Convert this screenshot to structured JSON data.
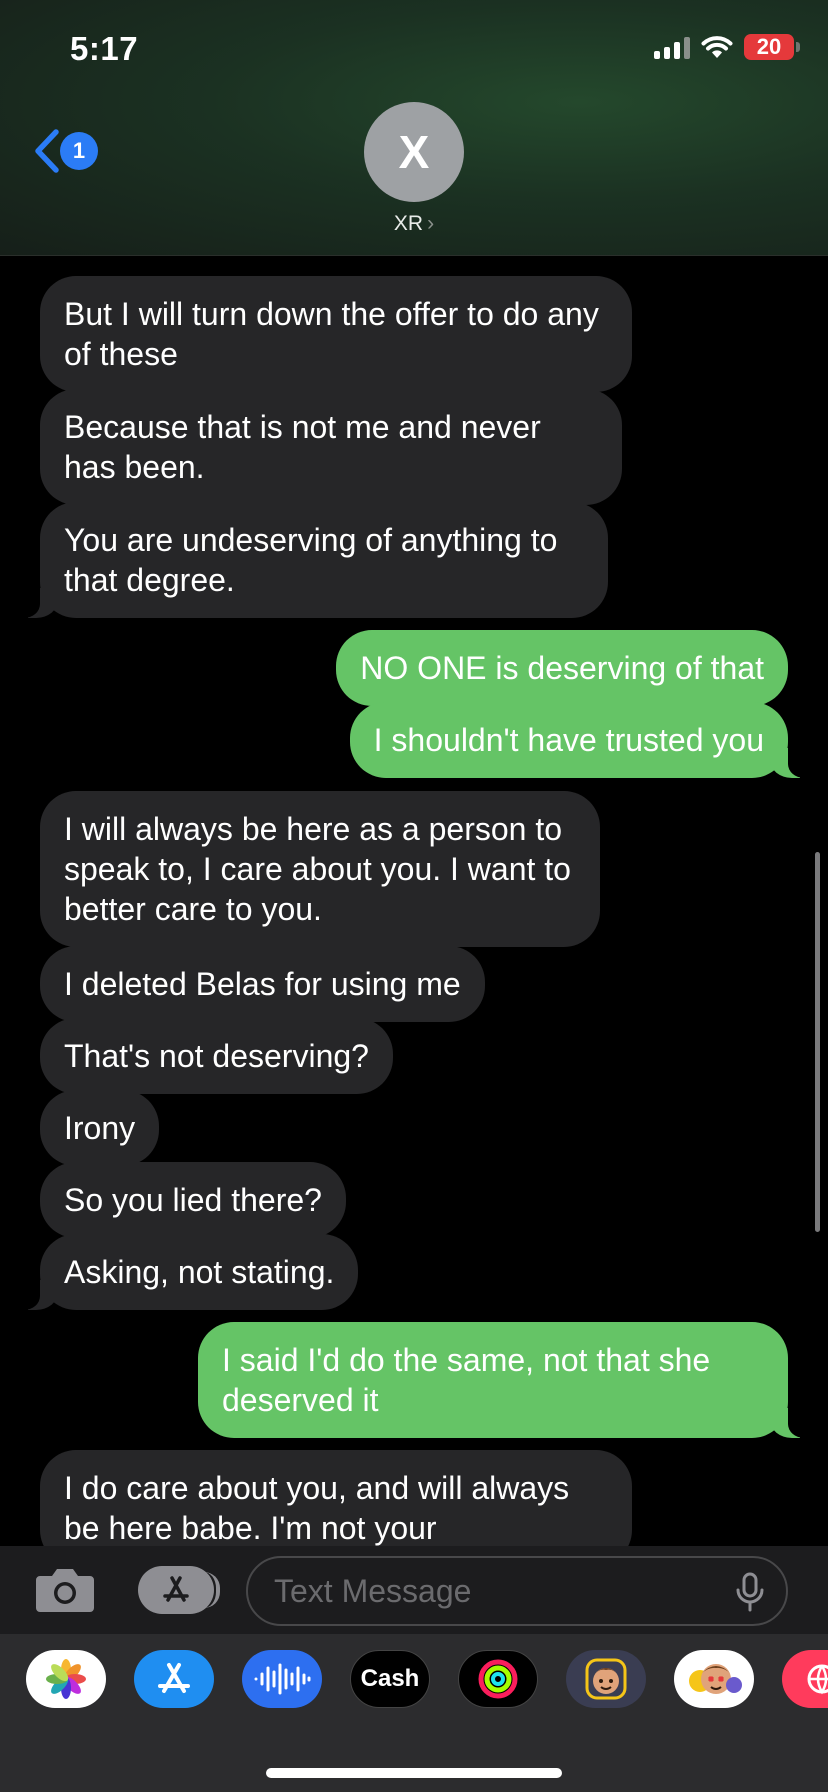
{
  "status": {
    "time": "5:17",
    "battery": "20"
  },
  "header": {
    "back_badge": "1",
    "avatar_initial": "X",
    "contact_name": "XR",
    "chevron": "›"
  },
  "messages": [
    {
      "from": "them",
      "text": "But I will turn down the offer to do any of these"
    },
    {
      "from": "them",
      "text": "Because that is not me and never has been."
    },
    {
      "from": "them",
      "text": "You are undeserving of anything to that degree."
    },
    {
      "from": "me",
      "text": "NO ONE is deserving of that"
    },
    {
      "from": "me",
      "text": "I shouldn't have trusted you"
    },
    {
      "from": "them",
      "text": "I will always be here as a person to speak to, I care about you. I want to better care to you."
    },
    {
      "from": "them",
      "text": "I deleted Belas for using me"
    },
    {
      "from": "them",
      "text": "That's not deserving?"
    },
    {
      "from": "them",
      "text": "Irony"
    },
    {
      "from": "them",
      "text": "So you lied there?"
    },
    {
      "from": "them",
      "text": "Asking, not stating."
    },
    {
      "from": "me",
      "text": "I said I'd do the same, not that she deserved it"
    },
    {
      "from": "them",
      "text": "I do care about you, and will always be here babe. I'm not your"
    }
  ],
  "input": {
    "placeholder": "Text Message"
  },
  "apps": [
    {
      "name": "photos-app"
    },
    {
      "name": "app-store-app"
    },
    {
      "name": "audio-message-app"
    },
    {
      "name": "apple-cash-app",
      "label": "Cash"
    },
    {
      "name": "fitness-app"
    },
    {
      "name": "memoji-stickers-app"
    },
    {
      "name": "animoji-app"
    },
    {
      "name": "web-search-app"
    }
  ],
  "colors": {
    "sent_bubble": "#65c466",
    "received_bubble": "#262628",
    "accent_blue": "#2b7cf6",
    "battery_red": "#e5393b"
  }
}
